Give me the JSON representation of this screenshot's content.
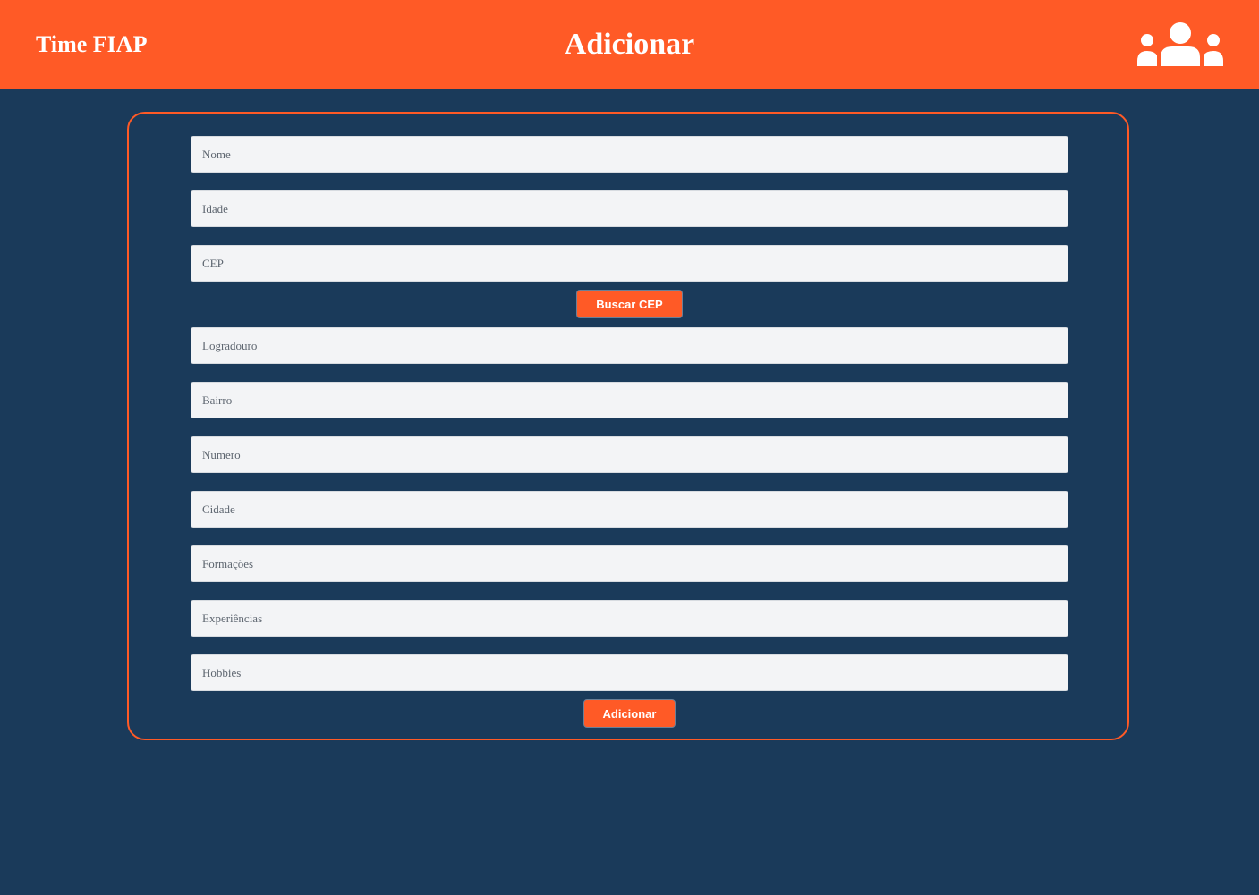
{
  "header": {
    "brand": "Time FIAP",
    "title": "Adicionar",
    "icon": "users-group-icon",
    "background_color": "#ff5a26"
  },
  "form": {
    "fields": [
      {
        "placeholder": "Nome",
        "value": ""
      },
      {
        "placeholder": "Idade",
        "value": ""
      },
      {
        "placeholder": "CEP",
        "value": ""
      },
      {
        "placeholder": "Logradouro",
        "value": ""
      },
      {
        "placeholder": "Bairro",
        "value": ""
      },
      {
        "placeholder": "Numero",
        "value": ""
      },
      {
        "placeholder": "Cidade",
        "value": ""
      },
      {
        "placeholder": "Formações",
        "value": ""
      },
      {
        "placeholder": "Experiências",
        "value": ""
      },
      {
        "placeholder": "Hobbies",
        "value": ""
      }
    ],
    "buscar_cep_label": "Buscar CEP",
    "submit_label": "Adicionar"
  },
  "colors": {
    "accent": "#ff5a26",
    "page_background": "#1a3a5a",
    "input_background": "#f3f4f6"
  }
}
